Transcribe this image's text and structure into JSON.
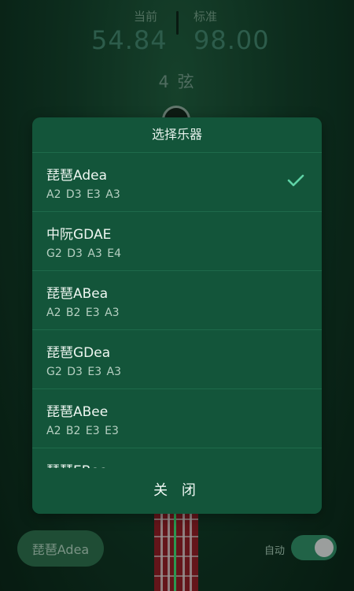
{
  "readout": {
    "current_label": "当前",
    "current_value": "54.84",
    "standard_label": "标准",
    "standard_value": "98.00",
    "string_label": "4 弦"
  },
  "bottom": {
    "instrument_button": "琵琶Adea",
    "auto_label": "自动",
    "auto_on": true
  },
  "dialog": {
    "title": "选择乐器",
    "close_label": "关 闭",
    "items": [
      {
        "name": "琵琶Adea",
        "notes": "A2  D3 E3  A3",
        "selected": true
      },
      {
        "name": "中阮GDAE",
        "notes": "G2  D3 A3  E4",
        "selected": false
      },
      {
        "name": "琵琶ABea",
        "notes": "A2  B2 E3  A3",
        "selected": false
      },
      {
        "name": "琵琶GDea",
        "notes": "G2 D3 E3  A3",
        "selected": false
      },
      {
        "name": "琵琶ABee",
        "notes": "A2  B2 E3  E3",
        "selected": false
      },
      {
        "name": "琵琶EBee",
        "notes": "",
        "selected": false
      }
    ]
  },
  "colors": {
    "accent": "#2f8a63",
    "check": "#5fd3a6"
  }
}
